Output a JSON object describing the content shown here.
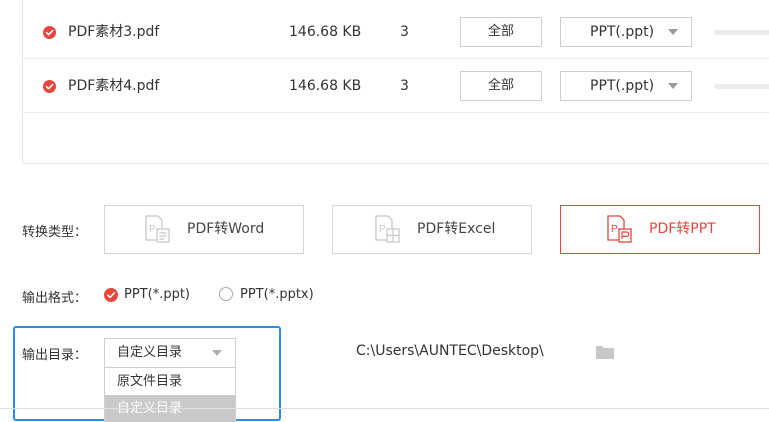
{
  "files": [
    {
      "name": "PDF素材3.pdf",
      "size": "146.68 KB",
      "pages": "3",
      "range_label": "全部",
      "format": "PPT(.ppt)",
      "checked": true
    },
    {
      "name": "PDF素材4.pdf",
      "size": "146.68 KB",
      "pages": "3",
      "range_label": "全部",
      "format": "PPT(.ppt)",
      "checked": true
    }
  ],
  "convert_type": {
    "label": "转换类型：",
    "options": [
      {
        "label": "PDF转Word",
        "active": false
      },
      {
        "label": "PDF转Excel",
        "active": false
      },
      {
        "label": "PDF转PPT",
        "active": true
      }
    ]
  },
  "output_format": {
    "label": "输出格式：",
    "options": [
      {
        "label": "PPT(*.ppt)",
        "selected": true
      },
      {
        "label": "PPT(*.pptx)",
        "selected": false
      }
    ]
  },
  "output_dir": {
    "label": "输出目录：",
    "selected": "自定义目录",
    "options": [
      "原文件目录",
      "自定义目录"
    ],
    "path": "C:\\Users\\AUNTEC\\Desktop\\"
  },
  "icons": {
    "check": "check-circle-icon",
    "pdf": "pdf-file-icon",
    "folder": "folder-icon",
    "dropdown": "chevron-down-icon"
  },
  "colors": {
    "accent": "#e8453c",
    "focus": "#2b8de8",
    "muted_icon": "#c8c8c8"
  }
}
